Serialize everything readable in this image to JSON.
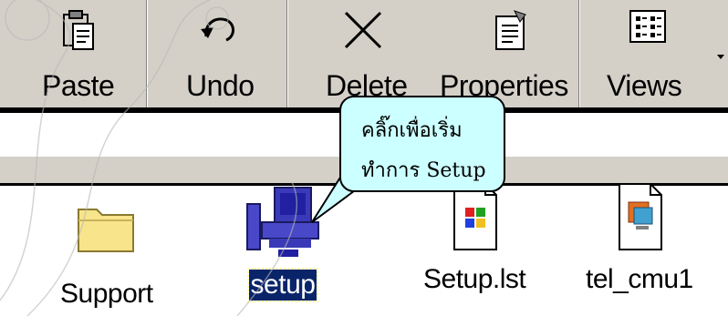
{
  "toolbar": {
    "paste_label": "Paste",
    "undo_label": "Undo",
    "delete_label": "Delete",
    "properties_label": "Properties",
    "views_label": "Views"
  },
  "files": [
    {
      "name": "Support",
      "icon": "folder-icon",
      "selected": false
    },
    {
      "name": "setup",
      "icon": "setup-computer-icon",
      "selected": true
    },
    {
      "name": "Setup.lst",
      "icon": "windows-document-icon",
      "selected": false
    },
    {
      "name": "tel_cmu1",
      "icon": "media-file-icon",
      "selected": false
    }
  ],
  "callout": {
    "line1": "คลิ๊กเพื่อเริ่ม",
    "line2": "ทำการ Setup"
  },
  "colors": {
    "toolbar_bg": "#d4d0c8",
    "callout_bg": "#ccffff",
    "selection_bg": "#0a246a",
    "folder_yellow": "#f7e48b"
  }
}
